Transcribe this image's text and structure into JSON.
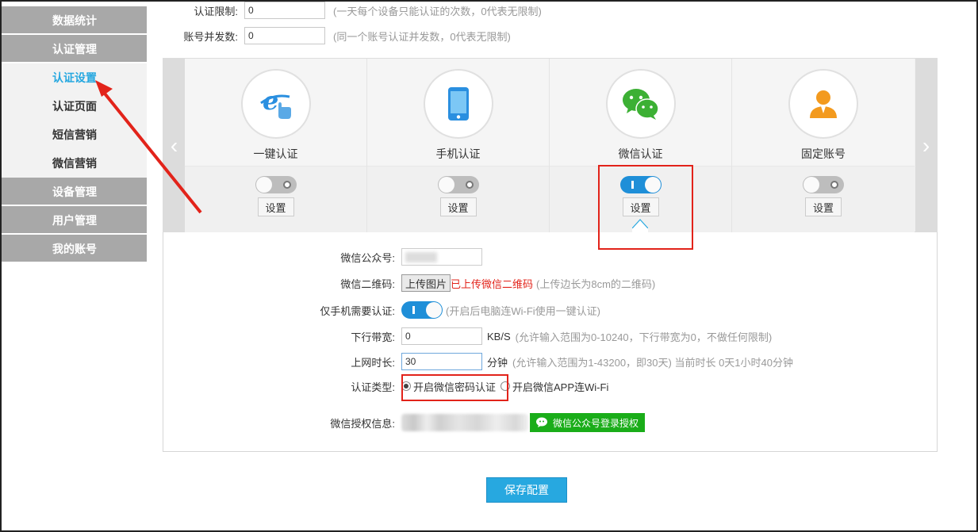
{
  "sidebar": {
    "groups": {
      "stats": "数据统计",
      "auth": "认证管理",
      "device": "设备管理",
      "user": "用户管理",
      "account": "我的账号"
    },
    "auth_items": [
      "认证设置",
      "认证页面",
      "短信营销",
      "微信营销"
    ],
    "active_item": "认证设置"
  },
  "top_settings": {
    "auth_limit": {
      "label": "认证限制:",
      "value": "0",
      "hint": "(一天每个设备只能认证的次数，0代表无限制)"
    },
    "concurrency": {
      "label": "账号并发数:",
      "value": "0",
      "hint": "(同一个账号认证并发数，0代表无限制)"
    }
  },
  "carousel": {
    "cards": [
      {
        "title": "一键认证",
        "icon": "ie-click-icon",
        "enabled": false,
        "button": "设置"
      },
      {
        "title": "手机认证",
        "icon": "phone-icon",
        "enabled": false,
        "button": "设置"
      },
      {
        "title": "微信认证",
        "icon": "wechat-icon",
        "enabled": true,
        "button": "设置"
      },
      {
        "title": "固定账号",
        "icon": "user-icon",
        "enabled": false,
        "button": "设置"
      }
    ],
    "prev": "‹",
    "next": "›"
  },
  "form": {
    "official_account": {
      "label": "微信公众号:"
    },
    "qr": {
      "label": "微信二维码:",
      "button": "上传图片",
      "status": "已上传微信二维码",
      "hint": "(上传边长为8cm的二维码)"
    },
    "mobile_only": {
      "label": "仅手机需要认证:",
      "enabled": true,
      "hint": "(开启后电脑连Wi-Fi使用一键认证)"
    },
    "bandwidth": {
      "label": "下行带宽:",
      "value": "0",
      "unit": "KB/S",
      "hint": "(允许输入范围为0-10240，下行带宽为0，不做任何限制)"
    },
    "online_time": {
      "label": "上网时长:",
      "value": "30",
      "unit": "分钟",
      "hint": "(允许输入范围为1-43200，即30天) 当前时长 0天1小时40分钟"
    },
    "auth_type": {
      "label": "认证类型:",
      "options": [
        "开启微信密码认证",
        "开启微信APP连Wi-Fi"
      ],
      "selected": 0
    },
    "authorization": {
      "label": "微信授权信息:",
      "button": "微信公众号登录授权"
    }
  },
  "save_button": "保存配置",
  "colors": {
    "accent": "#27a8e0",
    "toggle_on": "#1f8fd8",
    "highlight": "#e2231a",
    "wechat_green": "#1aad19"
  }
}
